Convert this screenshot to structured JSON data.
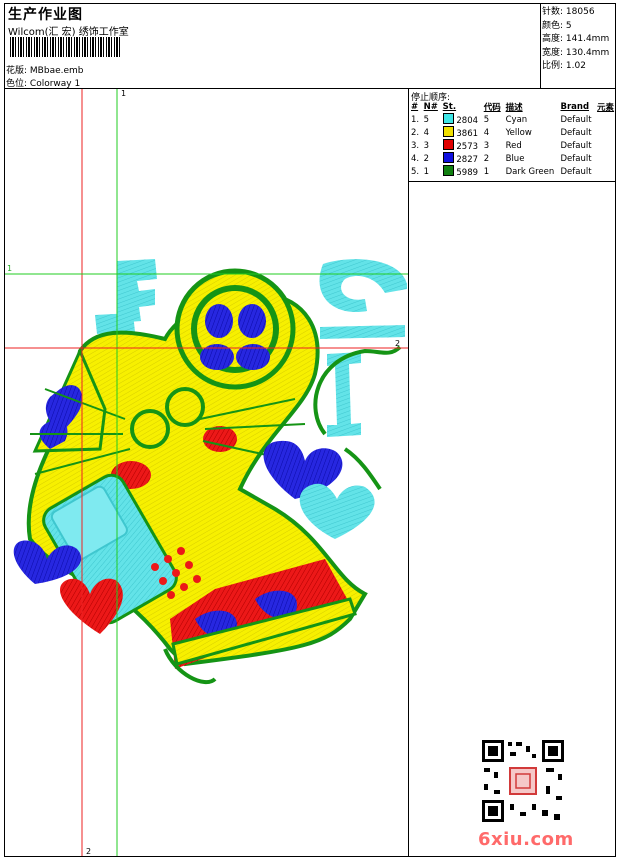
{
  "header": {
    "title": "生产作业图",
    "subtitle": "Wilcom(汇 宏) 绣饰工作室"
  },
  "file": {
    "design_label": "花版:",
    "design_value": "MBbae.emb",
    "colorway_label": "色位:",
    "colorway_value": "Colorway 1"
  },
  "stats": [
    {
      "label": "针数:",
      "value": "18056"
    },
    {
      "label": "颜色:",
      "value": "5"
    },
    {
      "label": "高度:",
      "value": "141.4mm"
    },
    {
      "label": "宽度:",
      "value": "130.4mm"
    },
    {
      "label": "比例:",
      "value": "1.02"
    }
  ],
  "stop_sequence": {
    "title": "停止顺序:",
    "headers": [
      "#",
      "N#",
      "St.",
      "代码",
      "描述",
      "Brand",
      "元素"
    ],
    "rows": [
      {
        "num": "1.",
        "n": "5",
        "color": "#3fe6e6",
        "code": "2804",
        "st": "5",
        "desc": "Cyan",
        "brand": "Default"
      },
      {
        "num": "2.",
        "n": "4",
        "color": "#f0e000",
        "code": "3861",
        "st": "4",
        "desc": "Yellow",
        "brand": "Default"
      },
      {
        "num": "3.",
        "n": "3",
        "color": "#e00000",
        "code": "2573",
        "st": "3",
        "desc": "Red",
        "brand": "Default"
      },
      {
        "num": "4.",
        "n": "2",
        "color": "#1010e0",
        "code": "2827",
        "st": "2",
        "desc": "Blue",
        "brand": "Default"
      },
      {
        "num": "5.",
        "n": "1",
        "color": "#108010",
        "code": "5989",
        "st": "1",
        "desc": "Dark Green",
        "brand": "Default"
      }
    ]
  },
  "guides": {
    "green_vertical_label": "1",
    "green_horizontal_label": "1",
    "red_horizontal_label": "2",
    "red_vertical_label": "2"
  },
  "watermark": {
    "site": "6xiu.com"
  },
  "colors": {
    "cyan": "#63e3e8",
    "yellow": "#f7f000",
    "red": "#e81010",
    "blue": "#1f1fd8",
    "green": "#159415",
    "guide_green": "#22cc22",
    "guide_red": "#ee2222"
  }
}
